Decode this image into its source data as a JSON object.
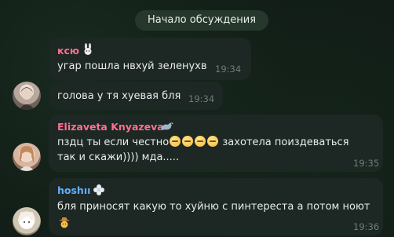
{
  "divider": {
    "label": "Начало обсуждения"
  },
  "messages": [
    {
      "name": "ксю",
      "name_color": "#ff6f91",
      "text": "угар пошла нвхуй зеленухв",
      "time": "19:34"
    },
    {
      "text": "голова у тя хуевая бля",
      "time": "19:34"
    },
    {
      "name": "Elizaveta Knyazeva",
      "name_color": "#ff6f91",
      "text_line1_a": "пздц ты если честно",
      "text_line1_b": "захотела поиздеваться",
      "text_line2": "так и скажи)))) мда.....",
      "time": "19:35"
    },
    {
      "name": "hoshıı",
      "name_color": "#5fb0ff",
      "text": "бля приносят какую то хуйню с пинтереста а потом ноют",
      "time": "19:36"
    }
  ]
}
